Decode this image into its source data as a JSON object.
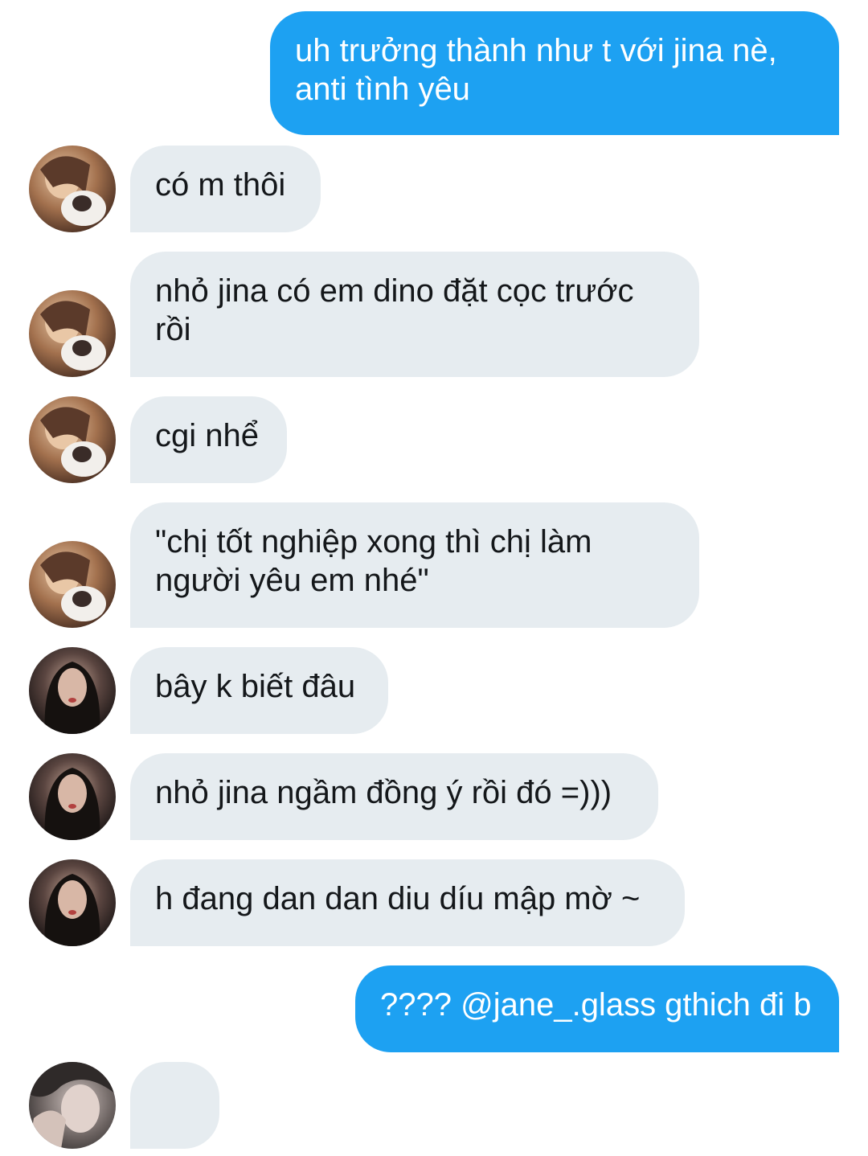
{
  "messages": [
    {
      "direction": "out",
      "text": "uh trưởng thành như t với jina nè,\nanti tình yêu"
    },
    {
      "direction": "in",
      "sender": "friend-a",
      "text": "có m thôi"
    },
    {
      "direction": "in",
      "sender": "friend-a",
      "text": "nhỏ jina có em dino đặt cọc trước\nrồi"
    },
    {
      "direction": "in",
      "sender": "friend-a",
      "text": "cgi nhể"
    },
    {
      "direction": "in",
      "sender": "friend-a",
      "text": "\"chị tốt nghiệp xong thì chị làm\nngười yêu em nhé\""
    },
    {
      "direction": "in",
      "sender": "friend-b",
      "text": "bây k biết đâu"
    },
    {
      "direction": "in",
      "sender": "friend-b",
      "text": "nhỏ jina ngầm đồng ý rồi đó =)))"
    },
    {
      "direction": "in",
      "sender": "friend-b",
      "text": "h đang dan dan diu díu mập mờ ~"
    },
    {
      "direction": "out",
      "text": "???? @jane_.glass gthich đi b"
    },
    {
      "direction": "in",
      "sender": "friend-c",
      "text": "🤷‍♀️"
    }
  ],
  "colors": {
    "outgoing_bubble": "#1da1f2",
    "incoming_bubble": "#e6ecf0",
    "incoming_text": "#14171a",
    "outgoing_text": "#ffffff"
  },
  "icons": {
    "friend-a": "avatar-photo-girl-with-cat",
    "friend-b": "avatar-photo-girl-dark-hair",
    "friend-c": "avatar-photo-girl-hand-on-face",
    "emoji": "person-shrugging-emoji"
  }
}
